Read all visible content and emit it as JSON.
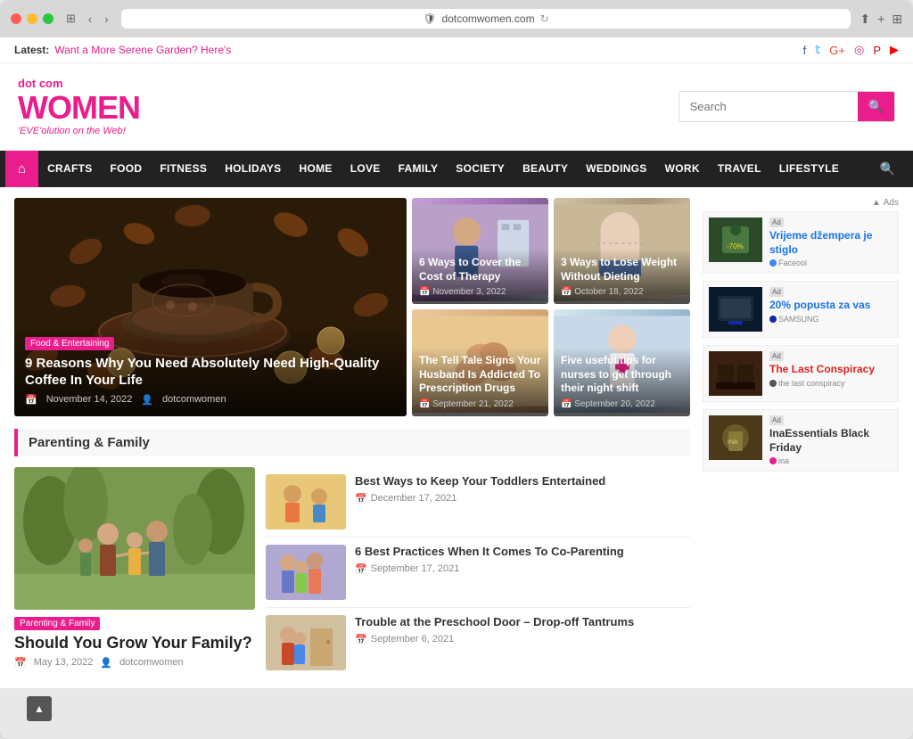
{
  "browser": {
    "url": "dotcomwomen.com",
    "reload_icon": "↻"
  },
  "topbar": {
    "latest_label": "Latest:",
    "latest_link": "Want a More Serene Garden? Here's",
    "social": [
      "f",
      "t",
      "G+",
      "♡",
      "P",
      "▶"
    ]
  },
  "header": {
    "logo_dotcom": "dot com",
    "logo_women": "WOMEN",
    "logo_tagline": "'EVE'olution on the Web!",
    "search_placeholder": "Search"
  },
  "nav": {
    "home_icon": "⌂",
    "items": [
      "CRAFTS",
      "FOOD",
      "FITNESS",
      "HOLIDAYS",
      "HOME",
      "LOVE",
      "FAMILY",
      "SOCIETY",
      "BEAUTY",
      "WEDDINGS",
      "WORK",
      "TRAVEL",
      "LIFESTYLE"
    ],
    "search_icon": "🔍"
  },
  "featured": {
    "category": "Food & Entertaining",
    "title": "9 Reasons Why You Need Absolutely Need High-Quality Coffee In Your Life",
    "date": "November 14, 2022",
    "author": "dotcomwomen"
  },
  "side_articles": [
    {
      "title": "6 Ways to Cover the Cost of Therapy",
      "date": "November 3, 2022"
    },
    {
      "title": "3 Ways to Lose Weight Without Dieting",
      "date": "October 18, 2022"
    },
    {
      "title": "The Tell Tale Signs Your Husband Is Addicted To Prescription Drugs",
      "date": "September 21, 2022"
    },
    {
      "title": "Five useful tips for nurses to get through their night shift",
      "date": "September 20, 2022"
    }
  ],
  "parenting": {
    "section_title": "Parenting & Family",
    "tag": "Parenting & Family",
    "main_title": "Should You Grow Your Family?",
    "main_date": "May 13, 2022",
    "main_author": "dotcomwomen",
    "articles": [
      {
        "title": "Best Ways to Keep Your Toddlers Entertained",
        "date": "December 17, 2021"
      },
      {
        "title": "6 Best Practices When It Comes To Co-Parenting",
        "date": "September 17, 2021"
      },
      {
        "title": "Trouble at the Preschool Door – Drop-off Tantrums",
        "date": "September 6, 2021"
      }
    ]
  },
  "ads": [
    {
      "title": "Vrijeme džempera je stiglo",
      "sponsored": "Faceool",
      "dot_color": "blue"
    },
    {
      "title": "20% popusta za vas",
      "sponsored": "SAMSUNG",
      "dot_color": "samsung"
    },
    {
      "title": "The Last Conspiracy",
      "sponsored": "the last conspiracy",
      "dot_color": "conspiracy"
    },
    {
      "title": "InaEssentials Black Friday",
      "sponsored": "ina",
      "dot_color": "ina"
    }
  ],
  "colors": {
    "pink": "#e91e8c",
    "nav_bg": "#222222",
    "link_blue": "#1a73e8"
  }
}
